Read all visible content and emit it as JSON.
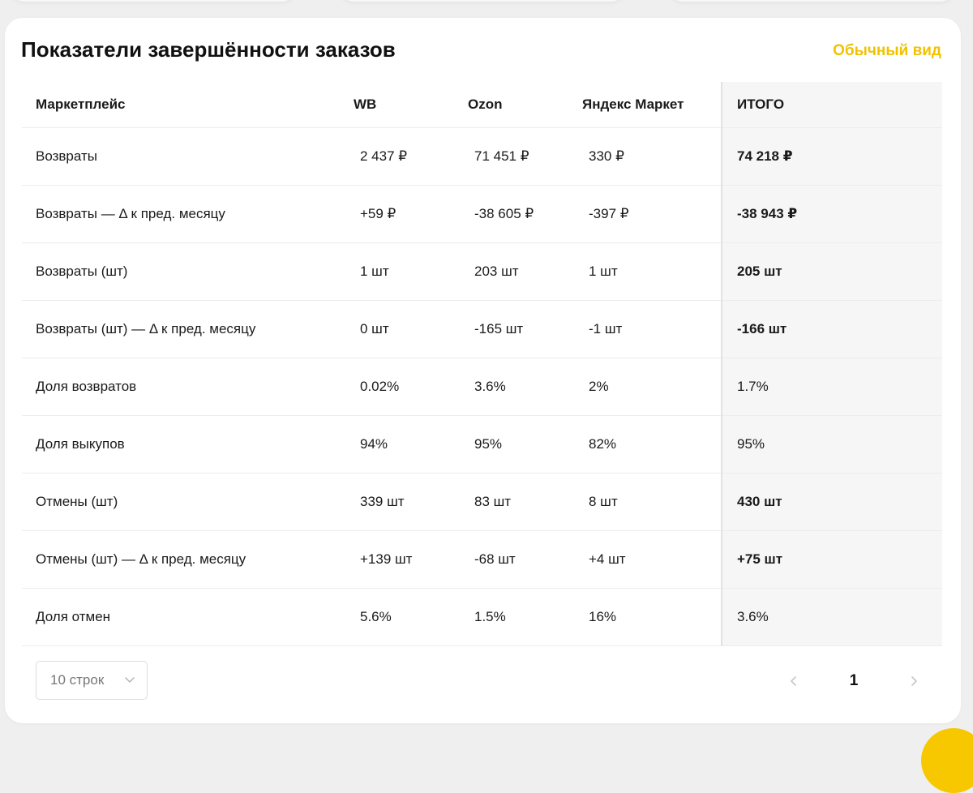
{
  "card": {
    "title": "Показатели завершённости заказов",
    "view_toggle_label": "Обычный вид"
  },
  "table": {
    "headers": {
      "name": "Маркетплейс",
      "wb": "WB",
      "ozon": "Ozon",
      "ym": "Яндекс Маркет",
      "total": "ИТОГО"
    },
    "rows": [
      {
        "name": "Возвраты",
        "wb": "2 437 ₽",
        "ozon": "71 451 ₽",
        "ym": "330 ₽",
        "total": "74 218 ₽"
      },
      {
        "name": "Возвраты — Δ к пред. месяцу",
        "wb": "+59 ₽",
        "ozon": "-38 605 ₽",
        "ym": "-397 ₽",
        "total": "-38 943 ₽"
      },
      {
        "name": "Возвраты (шт)",
        "wb": "1 шт",
        "ozon": "203 шт",
        "ym": "1 шт",
        "total": "205 шт"
      },
      {
        "name": "Возвраты (шт) — Δ к пред. месяцу",
        "wb": "0 шт",
        "ozon": "-165 шт",
        "ym": "-1 шт",
        "total": "-166 шт"
      },
      {
        "name": "Доля возвратов",
        "wb": "0.02%",
        "ozon": "3.6%",
        "ym": "2%",
        "total": "1.7%"
      },
      {
        "name": "Доля выкупов",
        "wb": "94%",
        "ozon": "95%",
        "ym": "82%",
        "total": "95%"
      },
      {
        "name": "Отмены (шт)",
        "wb": "339 шт",
        "ozon": "83 шт",
        "ym": "8 шт",
        "total": "430 шт"
      },
      {
        "name": "Отмены (шт) — Δ к пред. месяцу",
        "wb": "+139 шт",
        "ozon": "-68 шт",
        "ym": "+4 шт",
        "total": "+75 шт"
      },
      {
        "name": "Доля отмен",
        "wb": "5.6%",
        "ozon": "1.5%",
        "ym": "16%",
        "total": "3.6%"
      }
    ]
  },
  "pagination": {
    "page_size_label": "10 строк",
    "current_page": "1"
  },
  "colors": {
    "accent": "#f2c200",
    "positive": "#27a35a",
    "negative": "#e0483c",
    "neutral": "#999999"
  },
  "icons": {
    "page_size_dropdown": "chevron-down-icon",
    "prev_page": "chevron-left-icon",
    "next_page": "chevron-right-icon"
  }
}
